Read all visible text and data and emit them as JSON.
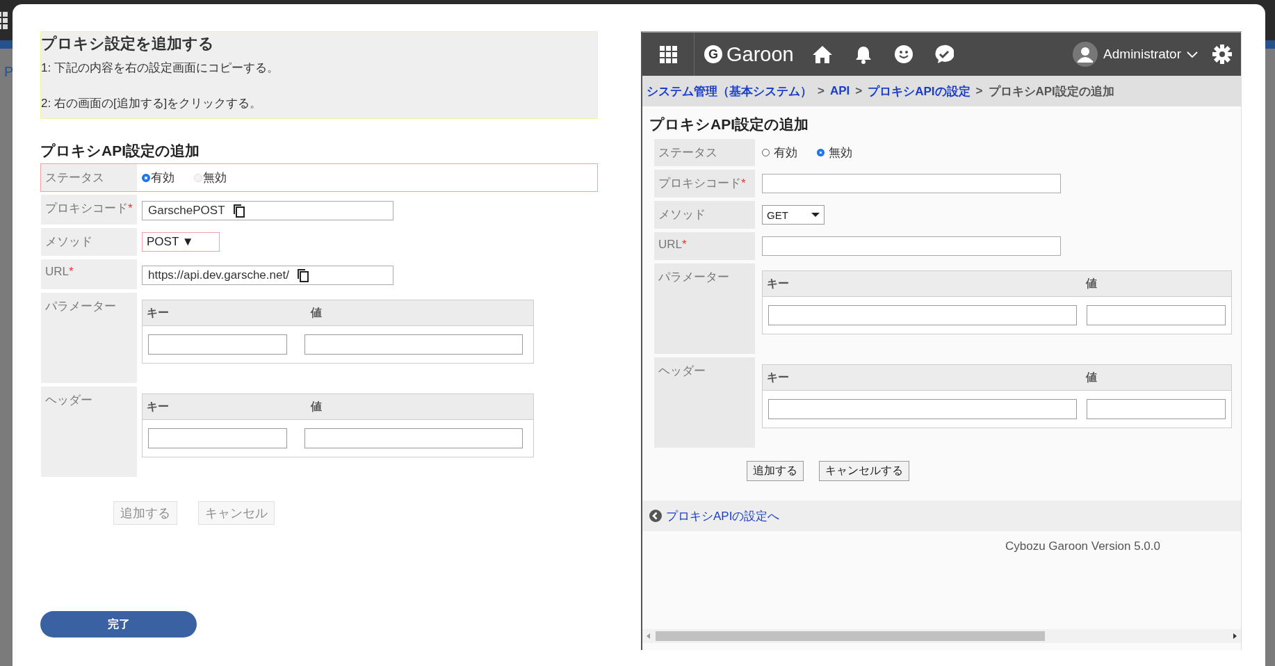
{
  "background_page": {
    "text": "P"
  },
  "instructions": {
    "title": "プロキシ設定を追加する",
    "steps": [
      "1: 下記の内容を右の設定画面にコピーする。",
      "2: 右の画面の[追加する]をクリックする。"
    ]
  },
  "source_form": {
    "title": "プロキシAPI設定の追加",
    "fields": [
      {
        "kind": "radio",
        "label": "ステータス",
        "highlighted": true,
        "options": [
          {
            "label": "有効",
            "selected": true,
            "disabled": false
          },
          {
            "label": "無効",
            "selected": false,
            "disabled": true
          }
        ]
      },
      {
        "kind": "copy",
        "label": "プロキシコード",
        "required_mark": "*",
        "value": "GarschePOST"
      },
      {
        "kind": "select",
        "label": "メソッド",
        "value": "POST",
        "arrow": "▼",
        "highlighted": true
      },
      {
        "kind": "copy",
        "label": "URL",
        "required_mark": "*",
        "value": "https://api.dev.garsche.net/"
      },
      {
        "kind": "pairs",
        "label": "パラメーター",
        "columns": [
          "キー",
          "値"
        ]
      },
      {
        "kind": "pairs",
        "label": "ヘッダー",
        "columns": [
          "キー",
          "値"
        ]
      }
    ],
    "buttons": [
      {
        "label": "追加する",
        "disabled": true
      },
      {
        "label": "キャンセル",
        "disabled": true
      }
    ]
  },
  "done_button": {
    "label": "完了"
  },
  "garoon": {
    "header": {
      "logo_letter": "G",
      "brand": "Garoon",
      "user": "Administrator"
    },
    "breadcrumb": [
      {
        "kind": "link",
        "text": "システム管理（基本システム）"
      },
      {
        "kind": "separator",
        "text": ">"
      },
      {
        "kind": "link",
        "text": "API"
      },
      {
        "kind": "separator",
        "text": ">"
      },
      {
        "kind": "link",
        "text": "プロキシAPIの設定"
      },
      {
        "kind": "separator",
        "text": ">"
      },
      {
        "kind": "current",
        "text": "プロキシAPI設定の追加"
      }
    ],
    "form": {
      "title": "プロキシAPI設定の追加",
      "fields": [
        {
          "kind": "radio",
          "label": "ステータス",
          "highlighted": false,
          "options": [
            {
              "label": "有効",
              "selected": false,
              "disabled": false
            },
            {
              "label": "無効",
              "selected": true,
              "disabled": false
            }
          ]
        },
        {
          "kind": "text",
          "label": "プロキシコード",
          "required_mark": "*"
        },
        {
          "kind": "select",
          "label": "メソッド",
          "value": "GET",
          "highlighted": false
        },
        {
          "kind": "text",
          "label": "URL",
          "required_mark": "*"
        },
        {
          "kind": "pairs",
          "label": "パラメーター",
          "columns": [
            "キー",
            "値"
          ]
        },
        {
          "kind": "pairs",
          "label": "ヘッダー",
          "columns": [
            "キー",
            "値"
          ]
        }
      ],
      "buttons": [
        {
          "label": "追加する",
          "disabled": false
        },
        {
          "label": "キャンセルする",
          "disabled": false
        }
      ]
    },
    "back_link": "プロキシAPIの設定へ",
    "version": "Cybozu Garoon Version 5.0.0"
  }
}
